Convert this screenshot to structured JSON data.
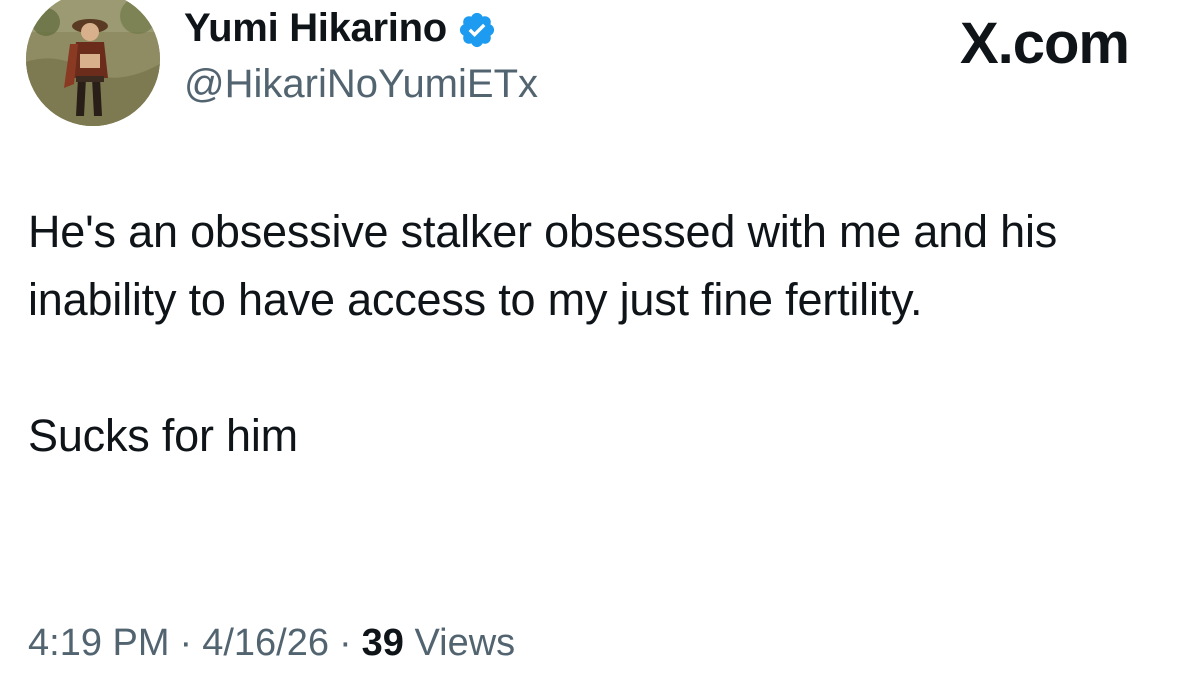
{
  "author": {
    "name": "Yumi Hikarino",
    "handle": "@HikariNoYumiETx",
    "verified_color": "#1d9bf0"
  },
  "brand": "X.com",
  "tweet": {
    "paragraphs": [
      "He's an obsessive stalker obsessed with me and his inability to have access to my just fine fertility.",
      "Sucks for him"
    ]
  },
  "meta": {
    "time": "4:19 PM",
    "separator": "·",
    "date": "4/16/26",
    "views_count": "39",
    "views_label": "Views"
  }
}
